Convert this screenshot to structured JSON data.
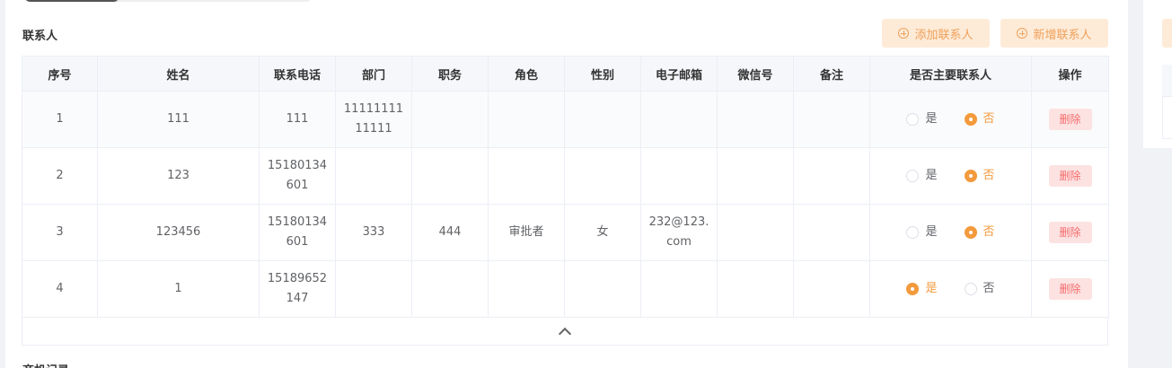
{
  "section": {
    "title": "联系人",
    "next_title": "商机记录"
  },
  "toolbar": {
    "add_label": "添加联系人",
    "new_label": "新增联系人"
  },
  "table": {
    "headers": [
      "序号",
      "姓名",
      "联系电话",
      "部门",
      "职务",
      "角色",
      "性别",
      "电子邮箱",
      "微信号",
      "备注",
      "是否主要联系人",
      "操作"
    ],
    "rows": [
      {
        "idx": "1",
        "name": "111",
        "phone": "111",
        "dept": "1111111111111",
        "title": "",
        "role": "",
        "gender": "",
        "email": "",
        "wechat": "",
        "note": "",
        "primary": false
      },
      {
        "idx": "2",
        "name": "123",
        "phone": "15180134601",
        "dept": "",
        "title": "",
        "role": "",
        "gender": "",
        "email": "",
        "wechat": "",
        "note": "",
        "primary": false
      },
      {
        "idx": "3",
        "name": "123456",
        "phone": "15180134601",
        "dept": "333",
        "title": "444",
        "role": "审批者",
        "gender": "女",
        "email": "232@123.com",
        "wechat": "",
        "note": "",
        "primary": false
      },
      {
        "idx": "4",
        "name": "1",
        "phone": "15189652147",
        "dept": "",
        "title": "",
        "role": "",
        "gender": "",
        "email": "",
        "wechat": "",
        "note": "",
        "primary": true
      }
    ],
    "radio_yes": "是",
    "radio_no": "否",
    "delete_label": "删除"
  },
  "colors": {
    "accent": "#f39a3c",
    "button_bg": "#fdebd8",
    "danger": "#f56c6c"
  },
  "icons": {
    "add": "plus-circle-icon",
    "collapse": "chevron-up-icon"
  }
}
